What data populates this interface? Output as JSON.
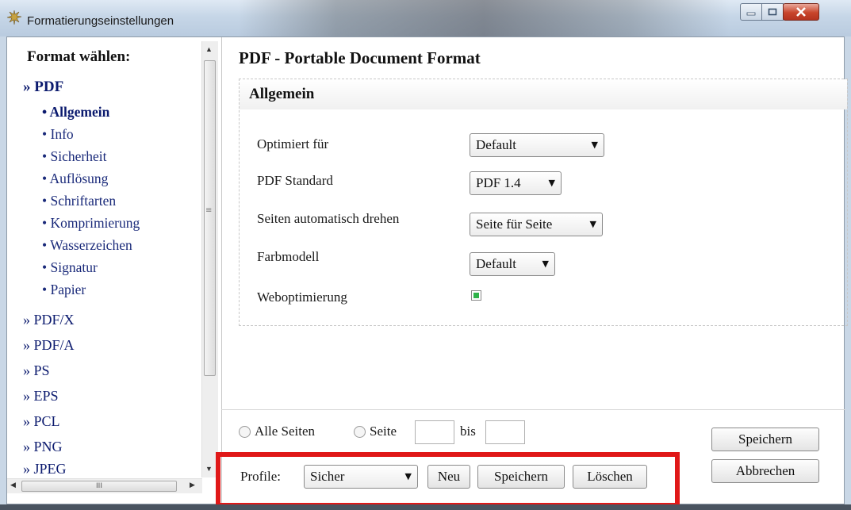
{
  "window": {
    "title": "Formatierungseinstellungen",
    "controls": [
      "minimize-icon",
      "maximize-icon",
      "close-icon"
    ]
  },
  "sidebar": {
    "heading": "Format wählen:",
    "formats": [
      {
        "label": "» PDF",
        "active": true
      },
      {
        "label": "» PDF/X"
      },
      {
        "label": "» PDF/A"
      },
      {
        "label": "» PS"
      },
      {
        "label": "» EPS"
      },
      {
        "label": "» PCL"
      },
      {
        "label": "» PNG"
      },
      {
        "label": "» JPEG"
      }
    ],
    "pdf_sections": [
      {
        "label": "• Allgemein",
        "active": true
      },
      {
        "label": "• Info"
      },
      {
        "label": "• Sicherheit"
      },
      {
        "label": "• Auflösung"
      },
      {
        "label": "• Schriftarten"
      },
      {
        "label": "• Komprimierung"
      },
      {
        "label": "• Wasserzeichen"
      },
      {
        "label": "• Signatur"
      },
      {
        "label": "• Papier"
      }
    ],
    "scroll_grip": "≡",
    "hscroll_grip": "III"
  },
  "main": {
    "title": "PDF - Portable Document Format",
    "group_title": "Allgemein",
    "fields": {
      "optimized_for": {
        "label": "Optimiert für",
        "value": "Default"
      },
      "pdf_standard": {
        "label": "PDF Standard",
        "value": "PDF 1.4"
      },
      "auto_rotate": {
        "label": "Seiten automatisch drehen",
        "value": "Seite für Seite"
      },
      "color_model": {
        "label": "Farbmodell",
        "value": "Default"
      },
      "web_optimization": {
        "label": "Weboptimierung",
        "checked": true
      }
    }
  },
  "pages": {
    "all_pages": "Alle Seiten",
    "page": "Seite",
    "to": "bis"
  },
  "profile": {
    "label": "Profile:",
    "value": "Sicher",
    "new": "Neu",
    "save": "Speichern",
    "delete": "Löschen"
  },
  "actions": {
    "save": "Speichern",
    "cancel": "Abbrechen"
  },
  "colors": {
    "highlight": "#e01818",
    "checkbox_mark": "#2fb34a",
    "nav_link": "#0b1a6e"
  }
}
